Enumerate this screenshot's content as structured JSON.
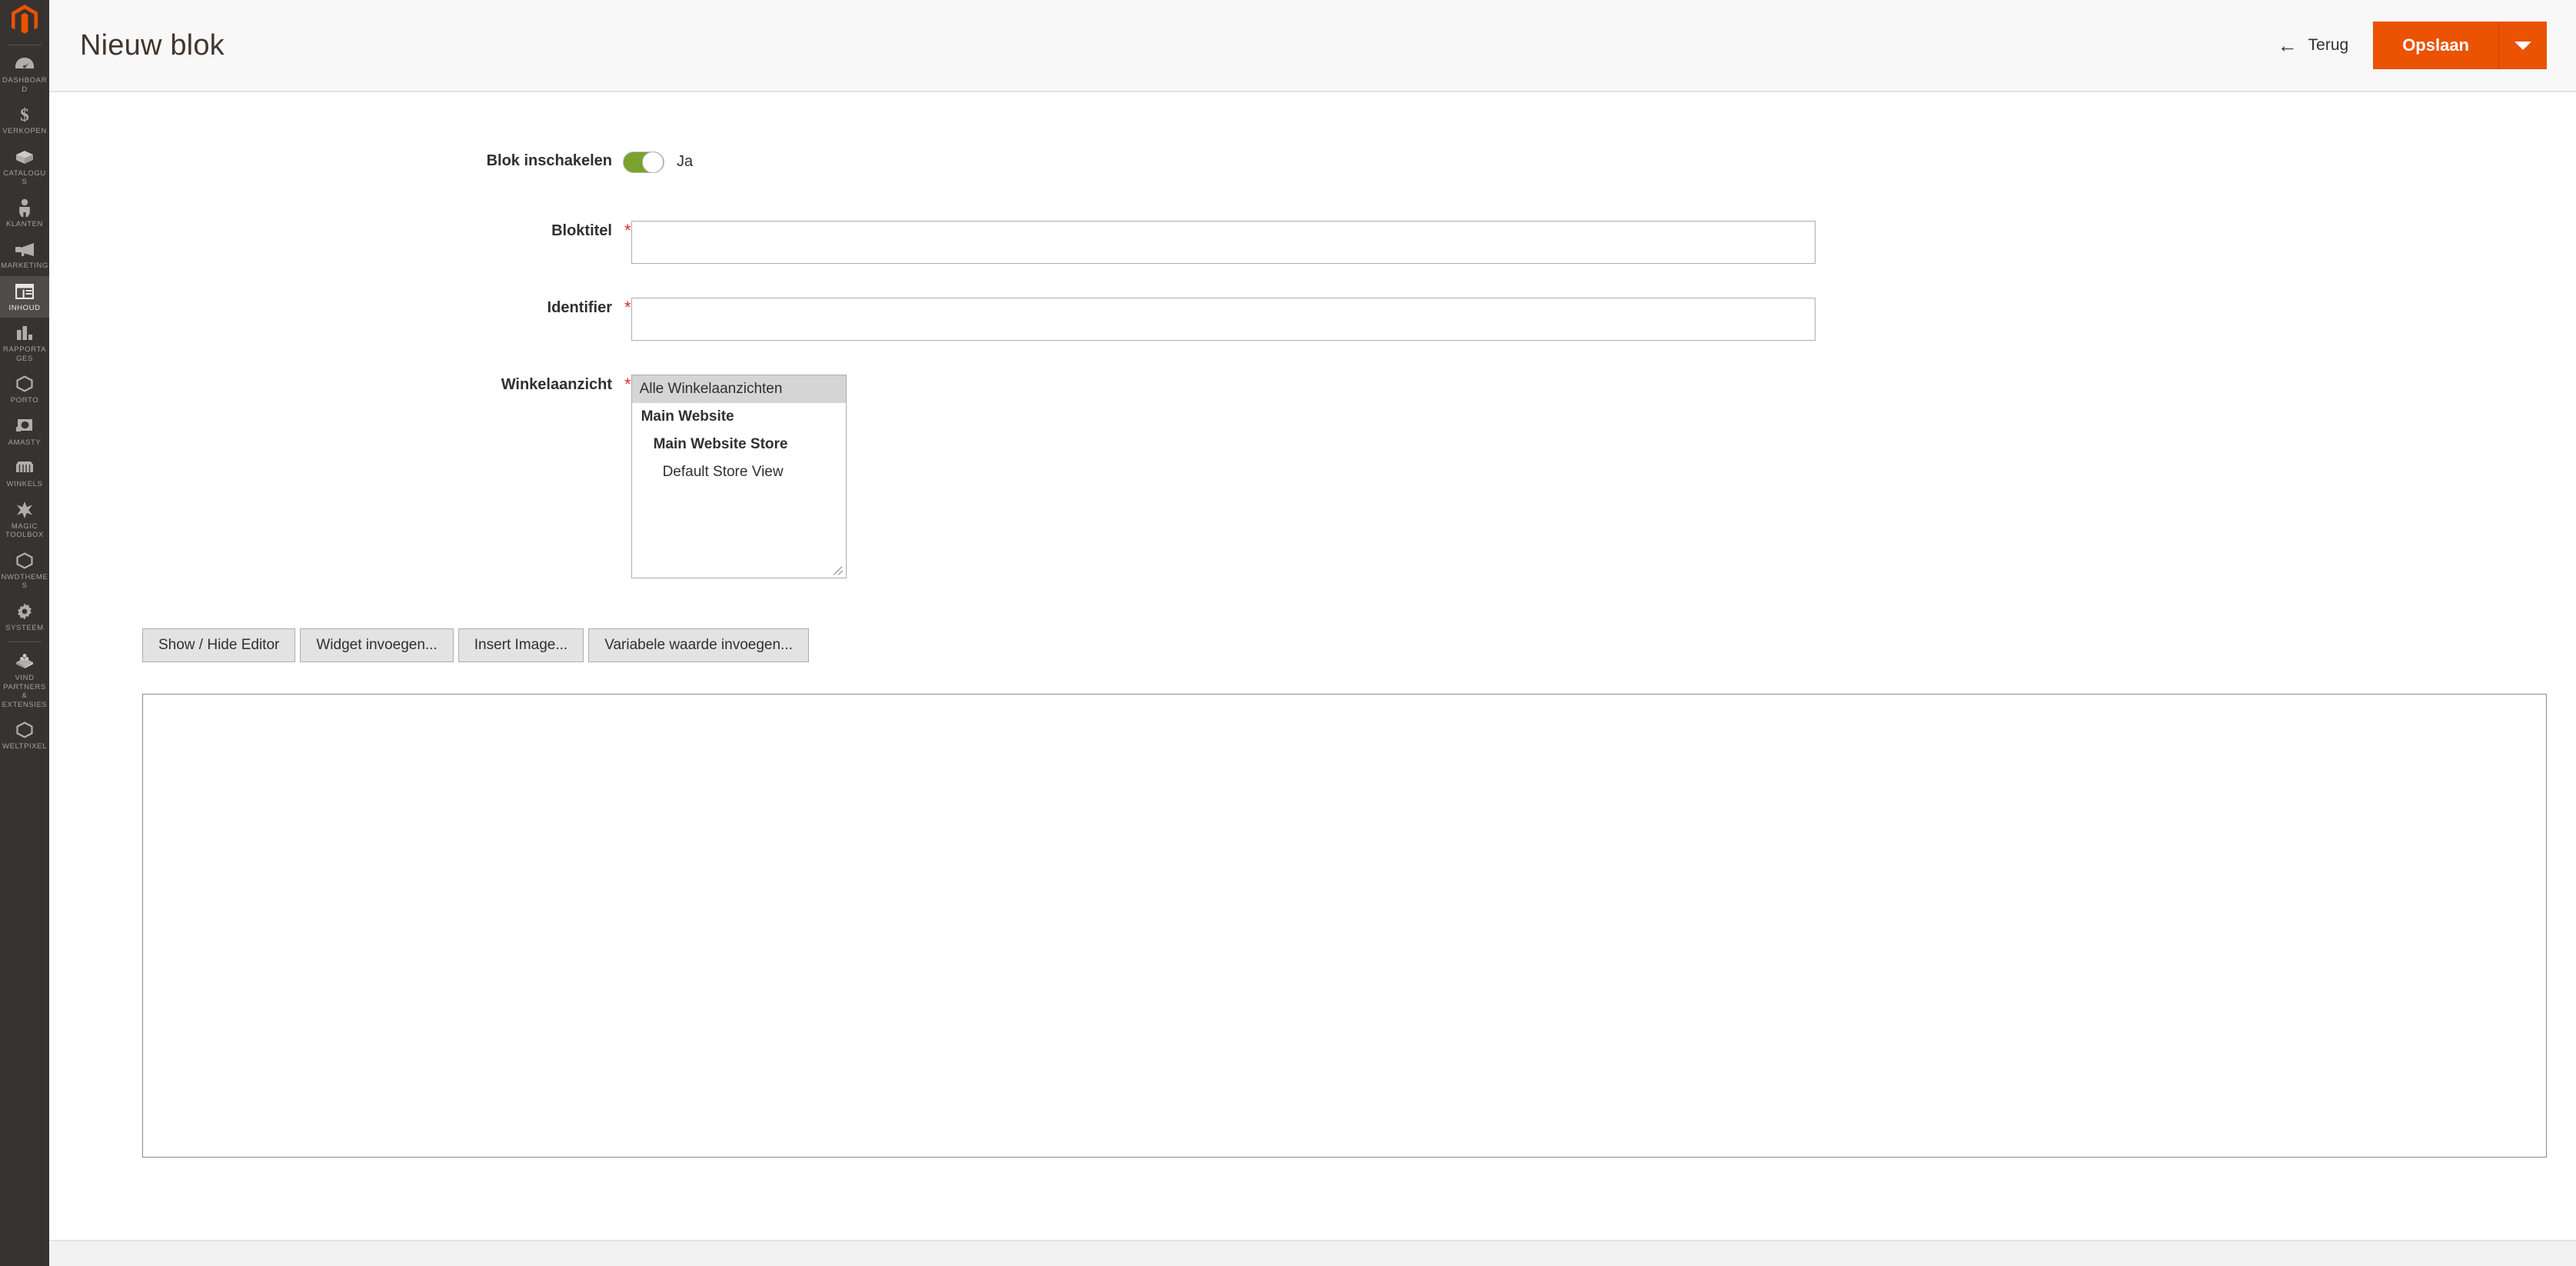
{
  "sidebar": {
    "logo": "magento-logo",
    "items": [
      {
        "label": "Dashboard",
        "icon": "dashboard-icon",
        "active": false
      },
      {
        "label": "Verkopen",
        "icon": "dollar-icon",
        "active": false
      },
      {
        "label": "Catalogus",
        "icon": "box-icon",
        "active": false
      },
      {
        "label": "Klanten",
        "icon": "person-icon",
        "active": false
      },
      {
        "label": "Marketing",
        "icon": "megaphone-icon",
        "active": false
      },
      {
        "label": "Inhoud",
        "icon": "layout-icon",
        "active": true
      },
      {
        "label": "Rapportages",
        "icon": "bar-chart-icon",
        "active": false
      },
      {
        "label": "Porto",
        "icon": "hexagon-icon",
        "active": false
      },
      {
        "label": "Amasty",
        "icon": "amasty-icon",
        "active": false
      },
      {
        "label": "Winkels",
        "icon": "storefront-icon",
        "active": false
      },
      {
        "label": "Magic Toolbox",
        "icon": "sparkle-icon",
        "active": false
      },
      {
        "label": "NWDTHEMES",
        "icon": "hexagon-icon",
        "active": false
      },
      {
        "label": "Systeem",
        "icon": "gear-icon",
        "active": false
      },
      {
        "label": "Vind Partners & Extensies",
        "icon": "extensions-icon",
        "active": false
      },
      {
        "label": "WeltPixel",
        "icon": "hexagon-icon",
        "active": false
      }
    ]
  },
  "header": {
    "title": "Nieuw blok",
    "back_label": "Terug",
    "back_icon": "arrow-left-icon",
    "save_label": "Opslaan",
    "save_caret_icon": "chevron-down-icon",
    "accent_color": "#eb5202"
  },
  "form": {
    "enable": {
      "label": "Blok inschakelen",
      "toggle_value": "Ja",
      "toggle_on": true,
      "toggle_color": "#79a22e"
    },
    "block_title": {
      "label": "Bloktitel",
      "required_marker": "*",
      "value": "",
      "placeholder": ""
    },
    "identifier": {
      "label": "Identifier",
      "required_marker": "*",
      "value": "",
      "placeholder": ""
    },
    "store_view": {
      "label": "Winkelaanzicht",
      "required_marker": "*",
      "options": [
        {
          "text": "Alle Winkelaanzichten",
          "level": 0,
          "selected": true
        },
        {
          "text": "Main Website",
          "level": 1,
          "selected": false
        },
        {
          "text": "Main Website Store",
          "level": 2,
          "selected": false
        },
        {
          "text": "Default Store View",
          "level": 3,
          "selected": false
        }
      ]
    },
    "editor_toolbar": {
      "buttons": [
        "Show / Hide Editor",
        "Widget invoegen...",
        "Insert Image...",
        "Variabele waarde invoegen..."
      ]
    },
    "content_editor": {
      "value": "",
      "placeholder": ""
    }
  }
}
